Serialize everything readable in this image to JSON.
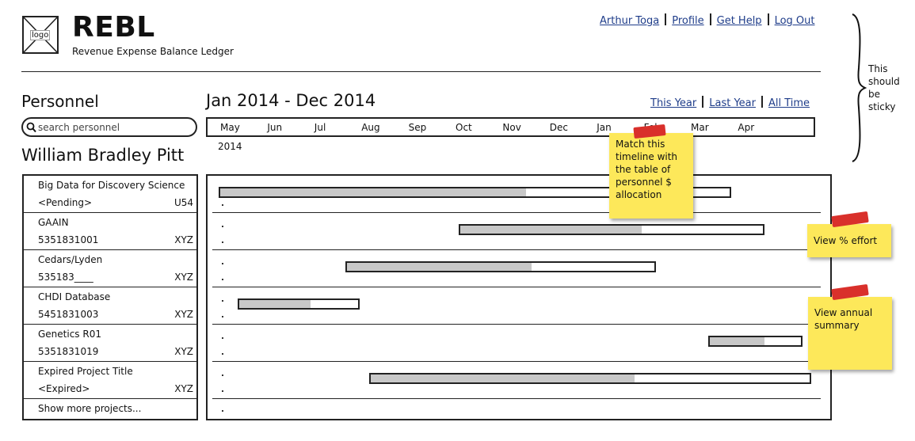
{
  "header": {
    "logo_label": "logo",
    "title": "REBL",
    "subtitle": "Revenue Expense Balance Ledger",
    "links": [
      "Arthur Toga",
      "Profile",
      "Get Help",
      "Log Out"
    ]
  },
  "sticky_annotation": [
    "This",
    "should",
    "be",
    "sticky"
  ],
  "sidebar": {
    "section_title": "Personnel",
    "search_placeholder": "search personnel",
    "person_name": "William Bradley Pitt",
    "projects": [
      {
        "name": "Big Data for Discovery Science",
        "code": "<Pending>",
        "grant": "U54"
      },
      {
        "name": "GAAIN",
        "code": "5351831001",
        "grant": "XYZ"
      },
      {
        "name": "Cedars/Lyden",
        "code": "535183____",
        "grant": "XYZ"
      },
      {
        "name": "CHDI Database",
        "code": "5451831003",
        "grant": "XYZ"
      },
      {
        "name": "Genetics R01",
        "code": "5351831019",
        "grant": "XYZ"
      },
      {
        "name": "Expired Project Title",
        "code": "<Expired>",
        "grant": "XYZ"
      }
    ],
    "show_more": "Show more projects..."
  },
  "timeline": {
    "date_range": "Jan 2014 - Dec 2014",
    "range_links": [
      "This Year",
      "Last Year",
      "All Time"
    ],
    "months": [
      "May",
      "Jun",
      "Jul",
      "Aug",
      "Sep",
      "Oct",
      "Nov",
      "Dec",
      "Jan",
      "Feb",
      "Mar",
      "Apr"
    ],
    "year_label": "2014",
    "allocations": [
      {
        "start_month": 0.0,
        "end_month": 10.9,
        "filled_fraction": 0.6
      },
      {
        "start_month": 5.1,
        "end_month": 11.6,
        "filled_fraction": 0.6
      },
      {
        "start_month": 2.7,
        "end_month": 9.3,
        "filled_fraction": 0.6
      },
      {
        "start_month": 0.4,
        "end_month": 3.0,
        "filled_fraction": 0.6
      },
      {
        "start_month": 10.4,
        "end_month": 12.4,
        "filled_fraction": 0.6
      },
      {
        "start_month": 3.2,
        "end_month": 12.6,
        "filled_fraction": 0.6
      }
    ]
  },
  "notes": {
    "timeline_match": "Match this timeline with the table of personnel $ allocation",
    "percent_effort": "View % effort",
    "annual_summary": "View annual summary"
  },
  "colors": {
    "link": "#1f3d8a",
    "note": "#fde85a",
    "tape": "#d9302b",
    "bar_fill": "#c8c8c8"
  }
}
